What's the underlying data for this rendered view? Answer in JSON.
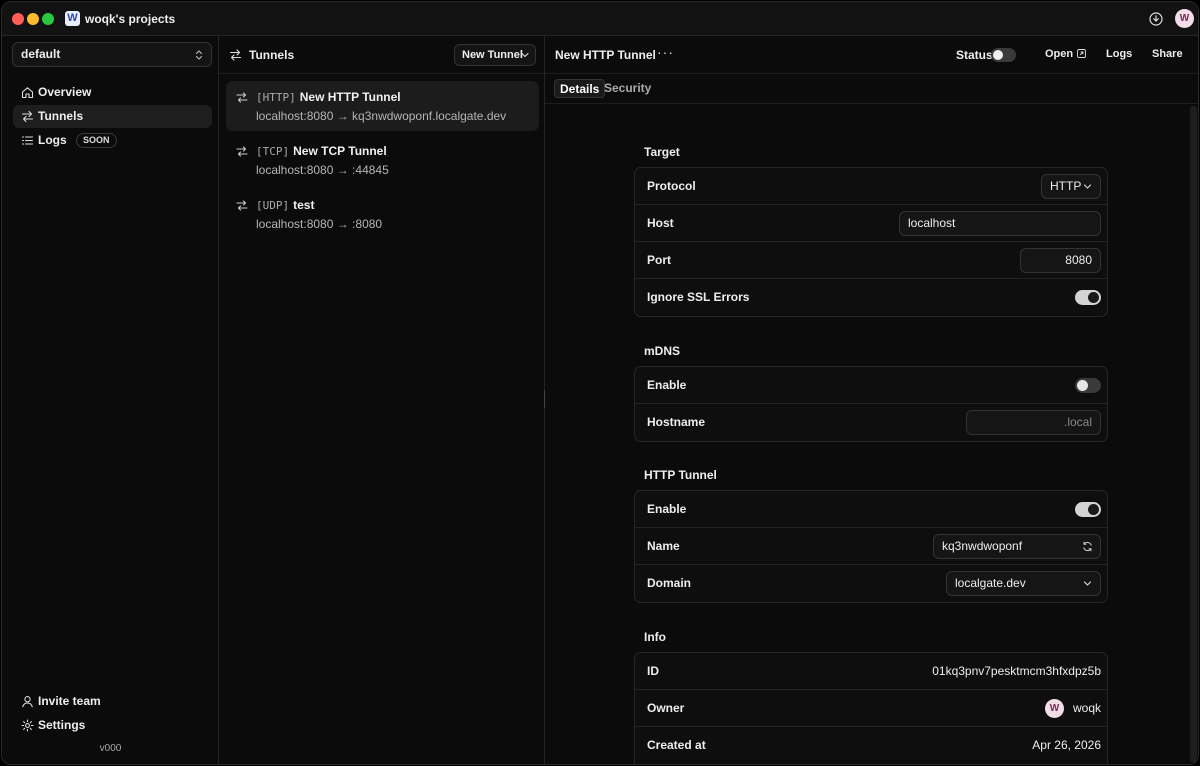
{
  "window": {
    "title": "woqk's projects",
    "app_logo": "W",
    "user_initial": "W"
  },
  "sidebar": {
    "workspace": "default",
    "items": [
      {
        "label": "Overview",
        "icon": "home-icon"
      },
      {
        "label": "Tunnels",
        "icon": "arrows-icon"
      },
      {
        "label": "Logs",
        "icon": "list-icon",
        "badge": "SOON"
      }
    ],
    "bottom": [
      {
        "label": "Invite team",
        "icon": "user-icon"
      },
      {
        "label": "Settings",
        "icon": "gear-icon"
      }
    ],
    "version": "v000"
  },
  "list": {
    "title": "Tunnels",
    "new_button": "New Tunnel",
    "tunnels": [
      {
        "type": "[HTTP]",
        "name": "New HTTP Tunnel",
        "route": "localhost:8080 → kq3nwdwoponf.localgate.dev"
      },
      {
        "type": "[TCP]",
        "name": "New TCP Tunnel",
        "route": "localhost:8080 → :44845"
      },
      {
        "type": "[UDP]",
        "name": "test",
        "route": "localhost:8080 → :8080"
      }
    ]
  },
  "detail": {
    "title": "New HTTP Tunnel",
    "more": "···",
    "status_label": "Status",
    "status_on": false,
    "open_label": "Open",
    "logs_label": "Logs",
    "share_label": "Share",
    "tabs": [
      "Details",
      "Security"
    ],
    "target": {
      "title": "Target",
      "protocol_label": "Protocol",
      "protocol_value": "HTTP",
      "host_label": "Host",
      "host_value": "localhost",
      "port_label": "Port",
      "port_value": "8080",
      "ssl_label": "Ignore SSL Errors",
      "ssl_on": true
    },
    "mdns": {
      "title": "mDNS",
      "enable_label": "Enable",
      "enable_on": false,
      "hostname_label": "Hostname",
      "hostname_placeholder": ".local"
    },
    "http_tunnel": {
      "title": "HTTP Tunnel",
      "enable_label": "Enable",
      "enable_on": true,
      "name_label": "Name",
      "name_value": "kq3nwdwoponf",
      "domain_label": "Domain",
      "domain_value": "localgate.dev"
    },
    "info": {
      "title": "Info",
      "id_label": "ID",
      "id_value": "01kq3pnv7pesktmcm3hfxdpz5b",
      "owner_label": "Owner",
      "owner_name": "woqk",
      "owner_initial": "W",
      "created_label": "Created at",
      "created_value": "Apr 26, 2026"
    }
  }
}
